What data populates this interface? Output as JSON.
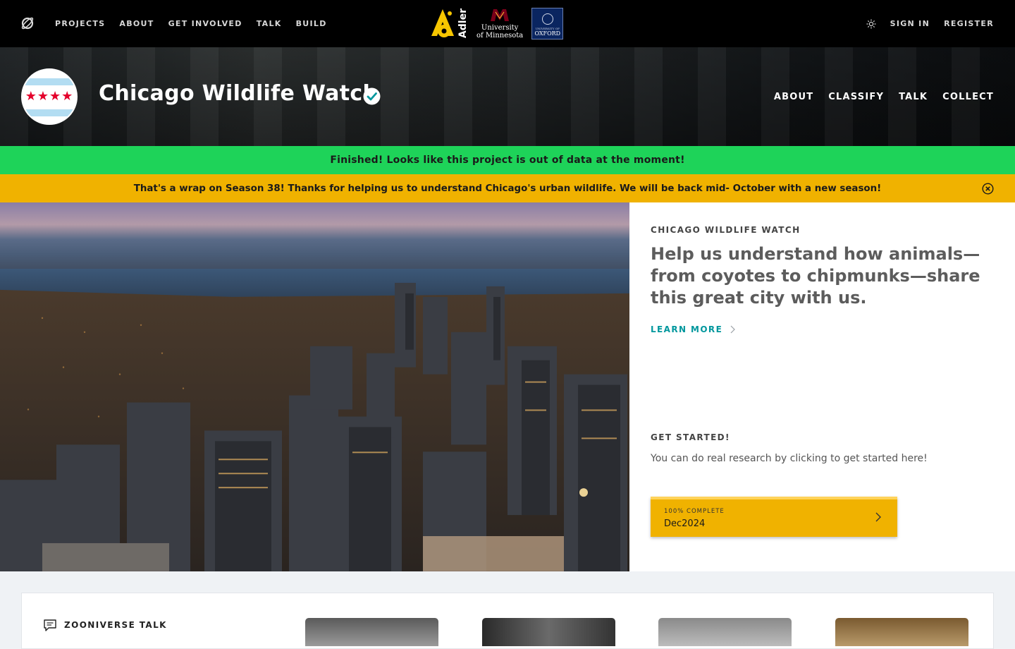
{
  "topnav": {
    "logo_icon": "zooniverse-logo-icon",
    "links": [
      "PROJECTS",
      "ABOUT",
      "GET INVOLVED",
      "TALK",
      "BUILD"
    ],
    "partners": {
      "adler": "Adler",
      "umn_line1": "University",
      "umn_line2": "of Minnesota",
      "oxford_small": "UNIVERSITY OF",
      "oxford": "OXFORD"
    },
    "theme_icon": "sun-icon",
    "sign_in": "SIGN IN",
    "register": "REGISTER"
  },
  "project": {
    "title": "Chicago Wildlife Watch",
    "avatar_stars": "★★★★",
    "verified_icon": "verified-check-icon",
    "nav": [
      "ABOUT",
      "CLASSIFY",
      "TALK",
      "COLLECT"
    ]
  },
  "banners": {
    "finished": "Finished! Looks like this project is out of data at the moment!",
    "season": "That's a wrap on Season 38! Thanks for helping us to understand Chicago's urban wildlife. We will be back mid- October with a new season!"
  },
  "hero": {
    "eyebrow": "CHICAGO WILDLIFE WATCH",
    "description": "Help us understand how animals—from coyotes to chipmunks—share this great city with us.",
    "learn_more": "LEARN MORE",
    "get_started_title": "GET STARTED!",
    "get_started_text": "You can do real research by clicking to get started here!",
    "workflow": {
      "progress_label": "100% COMPLETE",
      "progress_value": 1.0,
      "name": "Dec2024"
    }
  },
  "talk": {
    "title": "ZOONIVERSE TALK"
  },
  "colors": {
    "green_banner": "#1ed359",
    "yellow_banner": "#f0b200",
    "accent_teal": "#00979d",
    "nav_bg": "#000000"
  }
}
